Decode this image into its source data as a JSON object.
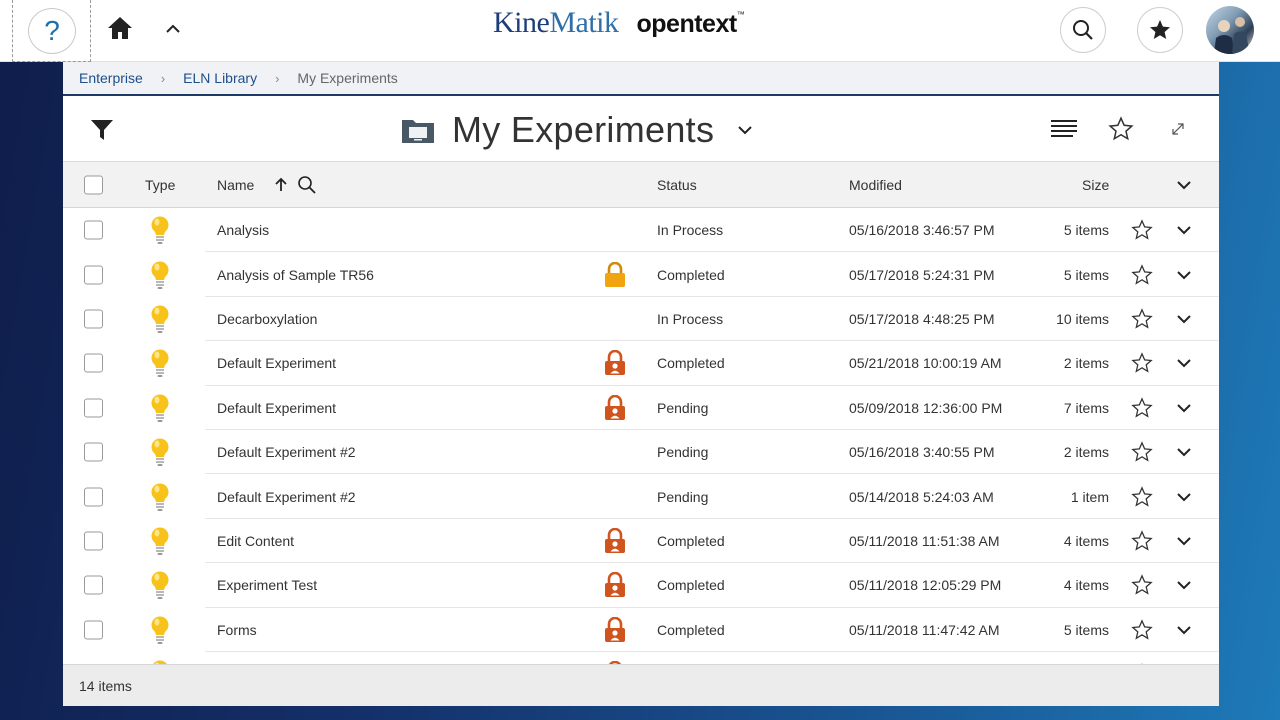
{
  "topbar": {
    "help_label": "?",
    "brand_part1": "Kine",
    "brand_part2": "Matik",
    "brand_opentext": "opentext",
    "brand_tm": "™"
  },
  "breadcrumb": {
    "items": [
      "Enterprise",
      "ELN Library"
    ],
    "current": "My Experiments",
    "separator": "›"
  },
  "header": {
    "title": "My Experiments"
  },
  "columns": {
    "type": "Type",
    "name": "Name",
    "status": "Status",
    "modified": "Modified",
    "size": "Size"
  },
  "rows": [
    {
      "name": "Analysis",
      "lock": "none",
      "status": "In Process",
      "modified": "05/16/2018 3:46:57 PM",
      "size": "5 items"
    },
    {
      "name": "Analysis of Sample TR56",
      "lock": "yellow",
      "status": "Completed",
      "modified": "05/17/2018 5:24:31 PM",
      "size": "5 items"
    },
    {
      "name": "Decarboxylation",
      "lock": "none",
      "status": "In Process",
      "modified": "05/17/2018 4:48:25 PM",
      "size": "10 items"
    },
    {
      "name": "Default Experiment",
      "lock": "orange",
      "status": "Completed",
      "modified": "05/21/2018 10:00:19 AM",
      "size": "2 items"
    },
    {
      "name": "Default Experiment",
      "lock": "orange",
      "status": "Pending",
      "modified": "05/09/2018 12:36:00 PM",
      "size": "7 items"
    },
    {
      "name": "Default Experiment #2",
      "lock": "none",
      "status": "Pending",
      "modified": "05/16/2018 3:40:55 PM",
      "size": "2 items"
    },
    {
      "name": "Default Experiment #2",
      "lock": "none",
      "status": "Pending",
      "modified": "05/14/2018 5:24:03 AM",
      "size": "1 item"
    },
    {
      "name": "Edit Content",
      "lock": "orange",
      "status": "Completed",
      "modified": "05/11/2018 11:51:38 AM",
      "size": "4 items"
    },
    {
      "name": "Experiment Test",
      "lock": "orange",
      "status": "Completed",
      "modified": "05/11/2018 12:05:29 PM",
      "size": "4 items"
    },
    {
      "name": "Forms",
      "lock": "orange",
      "status": "Completed",
      "modified": "05/11/2018 11:47:42 AM",
      "size": "5 items"
    },
    {
      "name": "",
      "lock": "orange",
      "status": "",
      "modified": "",
      "size": ""
    }
  ],
  "footer": {
    "count": "14 items"
  },
  "colors": {
    "accent": "#1d3a66",
    "lock_orange": "#d0541e",
    "lock_yellow": "#f2a310",
    "bulb": "#f7c21a"
  },
  "icons": {
    "help": "help-icon",
    "home": "home-icon",
    "up": "chevron-up-icon",
    "search": "search-icon",
    "favorites": "star-icon",
    "filter": "filter-icon",
    "folder": "folder-icon",
    "list_view": "list-view-icon",
    "expand": "expand-icon",
    "type": "lightbulb-icon",
    "lock": "lock-icon"
  }
}
